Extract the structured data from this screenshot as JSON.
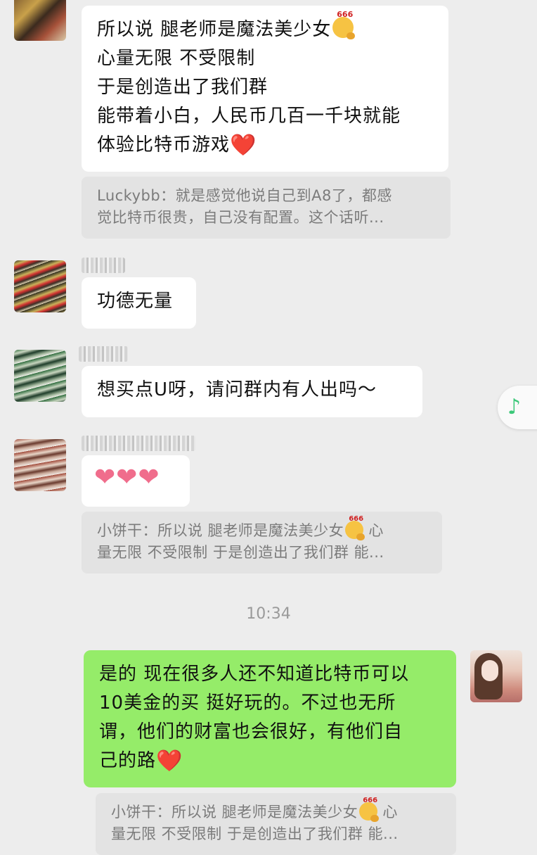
{
  "messages": [
    {
      "lines": [
        "所以说 腿老师是魔法美少女",
        "心量无限 不受限制",
        "于是创造出了我们群",
        "能带着小白，人民币几百一千块就能",
        "体验比特币游戏"
      ],
      "emoji_after_line1": "thinking-666-emoji",
      "emoji_after_line5": "red-heart-emoji"
    },
    {
      "quote_lines": [
        "Luckybb：就是感觉他说自己到A8了，都感",
        "觉比特币很贵，自己没有配置。这个话听..."
      ]
    },
    {
      "lines": [
        "功德无量"
      ]
    },
    {
      "lines": [
        "想买点U呀，请问群内有人出吗～"
      ]
    },
    {
      "emoji": [
        "pink-heart",
        "pink-heart",
        "pink-heart"
      ],
      "glyph": "❤"
    },
    {
      "quote_lines": [
        "小饼干：所以说 腿老师是魔法美少女",
        " 心",
        "量无限 不受限制  于是创造出了我们群 能..."
      ]
    }
  ],
  "timestamp": "10:34",
  "my_message": {
    "lines": [
      "是的 现在很多人还不知道比特币可以",
      "10美金的买  挺好玩的。不过也无所",
      "谓，他们的财富也会很好，有他们自",
      "己的路"
    ],
    "quote_lines": [
      "小饼干：所以说 腿老师是魔法美少女",
      " 心",
      "量无限 不受限制  于是创造出了我们群 能..."
    ]
  },
  "emoji_text": {
    "six": "666",
    "heart": "❤️"
  },
  "float_button": {
    "icon": "music-note-icon",
    "glyph": "♪"
  },
  "colors": {
    "background": "#ededed",
    "my_bubble": "#95ec69",
    "other_bubble": "#ffffff",
    "quote_bg": "#e3e3e3",
    "accent_green": "#3cc879"
  }
}
